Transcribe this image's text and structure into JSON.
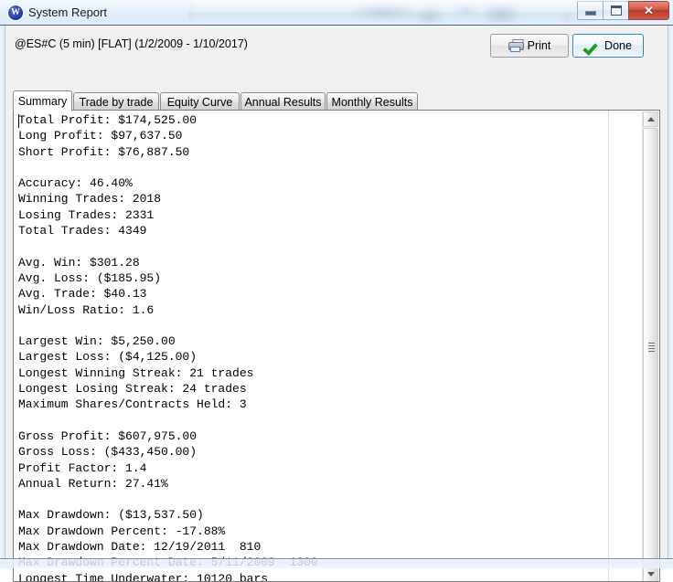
{
  "window": {
    "title": "System Report",
    "app_icon": "wealthlab-w-icon",
    "icon_letter": "W",
    "controls": {
      "minimize_label": "Minimize",
      "maximize_label": "Maximize",
      "close_label": "Close",
      "close_glyph": "✕"
    }
  },
  "toolbar": {
    "report_header": "@ES#C (5 min) [FLAT]  (1/2/2009 - 1/10/2017)",
    "print_label": "Print",
    "done_label": "Done"
  },
  "tabs": {
    "active_index": 0,
    "items": [
      {
        "label": "Summary"
      },
      {
        "label": "Trade by trade"
      },
      {
        "label": "Equity Curve"
      },
      {
        "label": "Annual Results"
      },
      {
        "label": "Monthly Results"
      }
    ]
  },
  "report": {
    "lines": [
      "Total Profit: $174,525.00",
      "Long Profit: $97,637.50",
      "Short Profit: $76,887.50",
      "",
      "Accuracy: 46.40%",
      "Winning Trades: 2018",
      "Losing Trades: 2331",
      "Total Trades: 4349",
      "",
      "Avg. Win: $301.28",
      "Avg. Loss: ($185.95)",
      "Avg. Trade: $40.13",
      "Win/Loss Ratio: 1.6",
      "",
      "Largest Win: $5,250.00",
      "Largest Loss: ($4,125.00)",
      "Longest Winning Streak: 21 trades",
      "Longest Losing Streak: 24 trades",
      "Maximum Shares/Contracts Held: 3",
      "",
      "Gross Profit: $607,975.00",
      "Gross Loss: ($433,450.00)",
      "Profit Factor: 1.4",
      "Annual Return: 27.41%",
      "",
      "Max Drawdown: ($13,537.50)",
      "Max Drawdown Percent: -17.88%",
      "Max Drawdown Date: 12/19/2011  810",
      "Max Drawdown Percent Date: 5/11/2009  1300",
      "Longest Time Underwater: 10120 bars"
    ],
    "metrics": {
      "total_profit": "$174,525.00",
      "long_profit": "$97,637.50",
      "short_profit": "$76,887.50",
      "accuracy": "46.40%",
      "winning_trades": "2018",
      "losing_trades": "2331",
      "total_trades": "4349",
      "avg_win": "$301.28",
      "avg_loss": "($185.95)",
      "avg_trade": "$40.13",
      "win_loss_ratio": "1.6",
      "largest_win": "$5,250.00",
      "largest_loss": "($4,125.00)",
      "longest_winning_streak": "21 trades",
      "longest_losing_streak": "24 trades",
      "maximum_shares_contracts_held": "3",
      "gross_profit": "$607,975.00",
      "gross_loss": "($433,450.00)",
      "profit_factor": "1.4",
      "annual_return": "27.41%",
      "max_drawdown": "($13,537.50)",
      "max_drawdown_percent": "-17.88%",
      "max_drawdown_date": "12/19/2011  810",
      "max_drawdown_percent_date": "5/11/2009  1300",
      "longest_time_underwater": "10120 bars"
    }
  },
  "scrollbar": {
    "up_arrow": "scroll-up-icon",
    "down_arrow": "scroll-down-icon"
  },
  "colors": {
    "titlebar_glass": "#dceafa",
    "client_background": "#f0f0f0",
    "text_background": "#ffffff",
    "close_button": "#c04a38",
    "done_accent": "#2f85c4",
    "check_green": "#1d9a23"
  }
}
